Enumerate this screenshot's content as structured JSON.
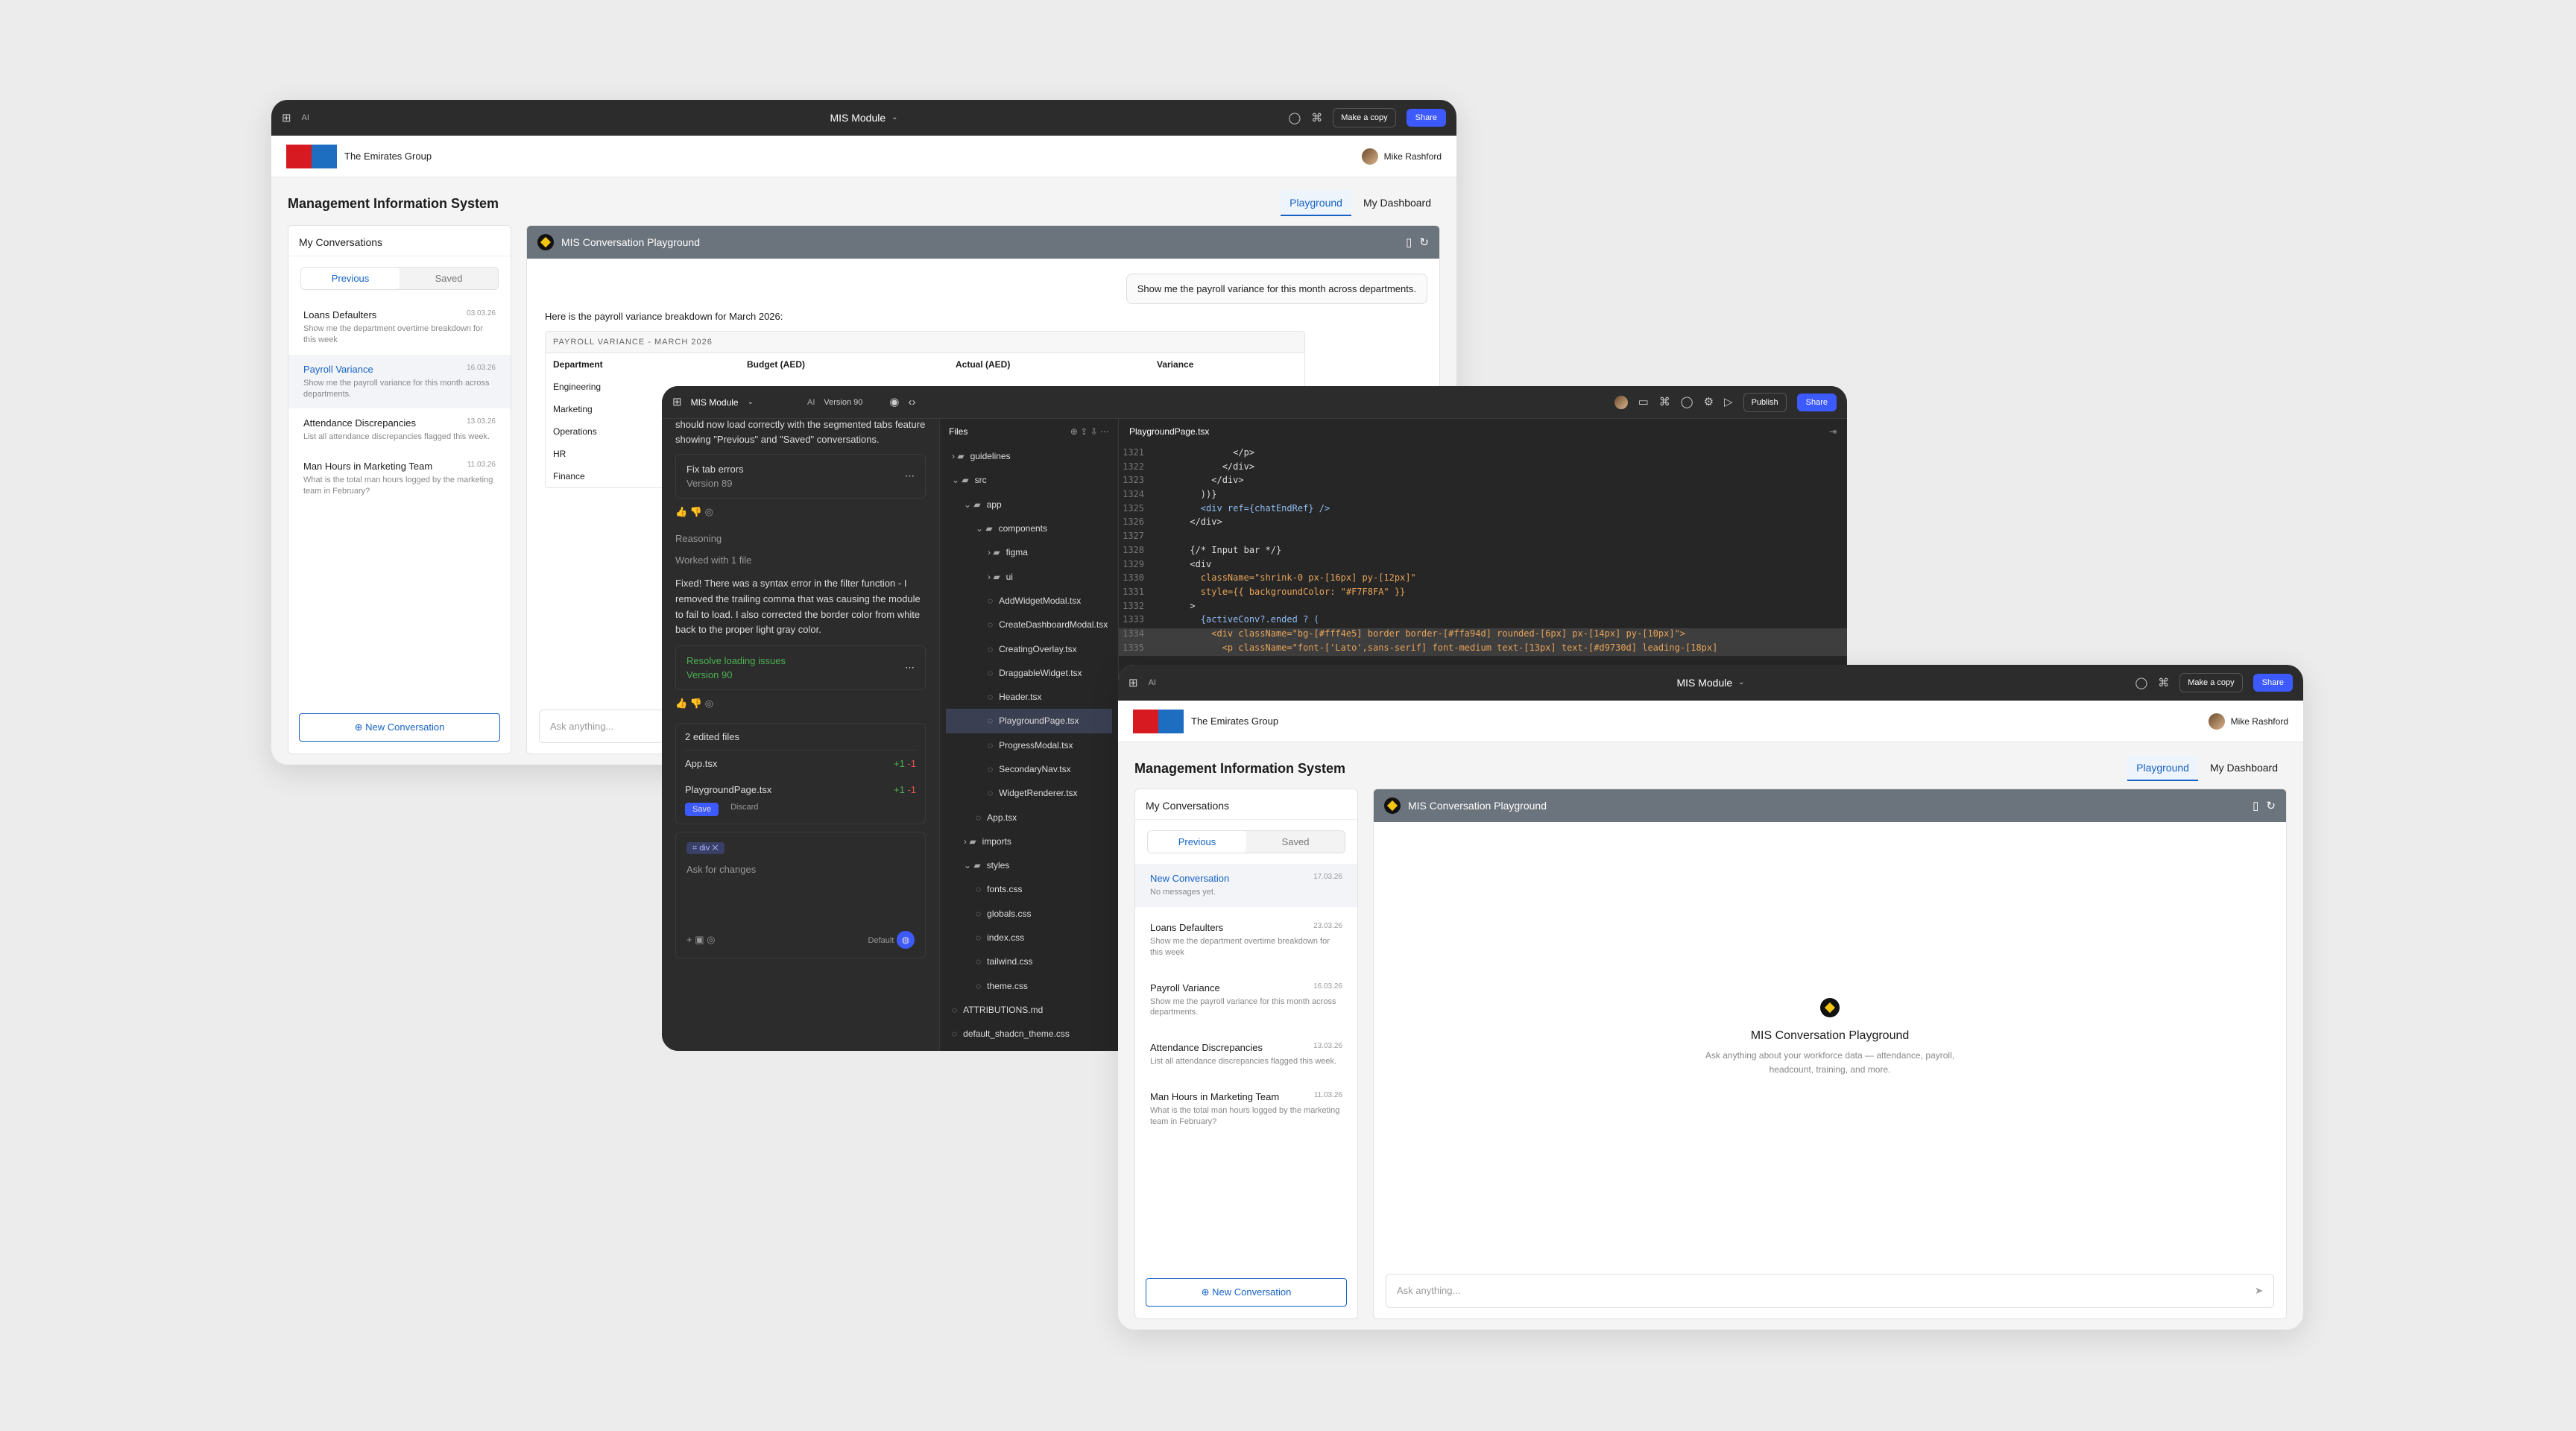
{
  "back_window": {
    "topbar": {
      "ai_label": "AI",
      "title": "MIS Module",
      "make_copy": "Make a copy",
      "share": "Share"
    },
    "app": {
      "company": "The Emirates Group",
      "user": "Mike Rashford"
    },
    "section_title": "Management Information System",
    "tabs": [
      "Playground",
      "My Dashboard"
    ],
    "sidebar": {
      "title": "My Conversations",
      "seg": [
        "Previous",
        "Saved"
      ],
      "items": [
        {
          "title": "Loans Defaulters",
          "date": "03.03.26",
          "sub": "Show me the department overtime breakdown for this week"
        },
        {
          "title": "Payroll Variance",
          "date": "16.03.26",
          "sub": "Show me the payroll variance for this month across departments."
        },
        {
          "title": "Attendance Discrepancies",
          "date": "13.03.26",
          "sub": "List all attendance discrepancies flagged this week."
        },
        {
          "title": "Man Hours in Marketing Team",
          "date": "11.03.26",
          "sub": "What is the total man hours logged by the marketing team in February?"
        }
      ],
      "new_conv": "New Conversation"
    },
    "main": {
      "header": "MIS Conversation Playground",
      "user_msg": "Show me the payroll variance for this month across departments.",
      "reply_intro": "Here is the payroll variance breakdown for March 2026:",
      "table_caption": "PAYROLL VARIANCE - MARCH 2026",
      "columns": [
        "Department",
        "Budget (AED)",
        "Actual (AED)",
        "Variance"
      ],
      "rows": [
        "Engineering",
        "Marketing",
        "Operations",
        "HR",
        "Finance"
      ],
      "ask_placeholder": "Ask anything..."
    }
  },
  "ide": {
    "topbar": {
      "title": "MIS Module",
      "ai_label": "AI",
      "version": "Version 90",
      "publish": "Publish",
      "share": "Share"
    },
    "chat": {
      "overflow_text": "should now load correctly with the segmented tabs feature showing \"Previous\" and \"Saved\" conversations.",
      "card1_title": "Fix tab errors",
      "card1_version": "Version 89",
      "reasoning": "Reasoning",
      "worked": "Worked with 1 file",
      "body": "Fixed! There was a syntax error in the filter function - I removed the trailing comma that was causing the module to fail to load. I also corrected the border color from white back to the proper light gray color.",
      "card2_title": "Resolve loading issues",
      "card2_version": "Version 90",
      "edited": "2 edited files",
      "files": [
        {
          "name": "App.tsx",
          "diff_add": "+1",
          "diff_del": "-1"
        },
        {
          "name": "PlaygroundPage.tsx",
          "diff_add": "+1",
          "diff_del": "-1"
        }
      ],
      "save": "Save",
      "discard": "Discard",
      "chip": "div",
      "ask_placeholder": "Ask for changes",
      "model": "Default"
    },
    "files": {
      "header": "Files",
      "tree": [
        {
          "name": "guidelines",
          "type": "folder",
          "depth": 0,
          "open": false
        },
        {
          "name": "src",
          "type": "folder",
          "depth": 0,
          "open": true
        },
        {
          "name": "app",
          "type": "folder",
          "depth": 1,
          "open": true
        },
        {
          "name": "components",
          "type": "folder",
          "depth": 2,
          "open": true
        },
        {
          "name": "figma",
          "type": "folder",
          "depth": 3,
          "open": false
        },
        {
          "name": "ui",
          "type": "folder",
          "depth": 3,
          "open": false
        },
        {
          "name": "AddWidgetModal.tsx",
          "type": "file",
          "depth": 3
        },
        {
          "name": "CreateDashboardModal.tsx",
          "type": "file",
          "depth": 3
        },
        {
          "name": "CreatingOverlay.tsx",
          "type": "file",
          "depth": 3
        },
        {
          "name": "DraggableWidget.tsx",
          "type": "file",
          "depth": 3
        },
        {
          "name": "Header.tsx",
          "type": "file",
          "depth": 3
        },
        {
          "name": "PlaygroundPage.tsx",
          "type": "file",
          "depth": 3,
          "selected": true
        },
        {
          "name": "ProgressModal.tsx",
          "type": "file",
          "depth": 3
        },
        {
          "name": "SecondaryNav.tsx",
          "type": "file",
          "depth": 3
        },
        {
          "name": "WidgetRenderer.tsx",
          "type": "file",
          "depth": 3
        },
        {
          "name": "App.tsx",
          "type": "file",
          "depth": 2
        },
        {
          "name": "imports",
          "type": "folder",
          "depth": 1,
          "open": false
        },
        {
          "name": "styles",
          "type": "folder",
          "depth": 1,
          "open": true
        },
        {
          "name": "fonts.css",
          "type": "file",
          "depth": 2
        },
        {
          "name": "globals.css",
          "type": "file",
          "depth": 2
        },
        {
          "name": "index.css",
          "type": "file",
          "depth": 2
        },
        {
          "name": "tailwind.css",
          "type": "file",
          "depth": 2
        },
        {
          "name": "theme.css",
          "type": "file",
          "depth": 2
        },
        {
          "name": "ATTRIBUTIONS.md",
          "type": "file",
          "depth": 0
        },
        {
          "name": "default_shadcn_theme.css",
          "type": "file",
          "depth": 0
        }
      ]
    },
    "code": {
      "filename": "PlaygroundPage.tsx",
      "lines": [
        {
          "n": "1321",
          "t": "              </p>"
        },
        {
          "n": "1322",
          "t": "            </div>"
        },
        {
          "n": "1323",
          "t": "          </div>"
        },
        {
          "n": "1324",
          "t": "        ))}"
        },
        {
          "n": "1325",
          "t": "        <div ref={chatEndRef} />"
        },
        {
          "n": "1326",
          "t": "      </div>"
        },
        {
          "n": "1327",
          "t": ""
        },
        {
          "n": "1328",
          "t": "      {/* Input bar */}"
        },
        {
          "n": "1329",
          "t": "      <div"
        },
        {
          "n": "1330",
          "t": "        className=\"shrink-0 px-[16px] py-[12px]\""
        },
        {
          "n": "1331",
          "t": "        style={{ backgroundColor: \"#F7F8FA\" }}"
        },
        {
          "n": "1332",
          "t": "      >"
        },
        {
          "n": "1333",
          "t": "        {activeConv?.ended ? ("
        },
        {
          "n": "1334",
          "t": "          <div className=\"bg-[#fff4e5] border border-[#ffa94d] rounded-[6px] px-[14px] py-[10px]\">"
        },
        {
          "n": "1335",
          "t": "            <p className=\"font-['Lato',sans-serif] font-medium text-[13px] text-[#d9730d] leading-[18px]"
        }
      ]
    }
  },
  "front_window": {
    "topbar": {
      "ai_label": "AI",
      "title": "MIS Module",
      "make_copy": "Make a copy",
      "share": "Share"
    },
    "app": {
      "company": "The Emirates Group",
      "user": "Mike Rashford"
    },
    "section_title": "Management Information System",
    "tabs": [
      "Playground",
      "My Dashboard"
    ],
    "sidebar": {
      "title": "My Conversations",
      "seg": [
        "Previous",
        "Saved"
      ],
      "items": [
        {
          "title": "New Conversation",
          "date": "17.03.26",
          "sub": "No messages yet."
        },
        {
          "title": "Loans Defaulters",
          "date": "23.03.26",
          "sub": "Show me the department overtime breakdown for this week"
        },
        {
          "title": "Payroll Variance",
          "date": "16.03.26",
          "sub": "Show me the payroll variance for this month across departments."
        },
        {
          "title": "Attendance Discrepancies",
          "date": "13.03.26",
          "sub": "List all attendance discrepancies flagged this week."
        },
        {
          "title": "Man Hours in Marketing Team",
          "date": "11.03.26",
          "sub": "What is the total man hours logged by the marketing team in February?"
        }
      ],
      "new_conv": "New Conversation"
    },
    "main": {
      "header": "MIS Conversation Playground",
      "empty_title": "MIS Conversation Playground",
      "empty_sub": "Ask anything about your workforce data — attendance, payroll, headcount, training, and more.",
      "ask_placeholder": "Ask anything..."
    }
  }
}
